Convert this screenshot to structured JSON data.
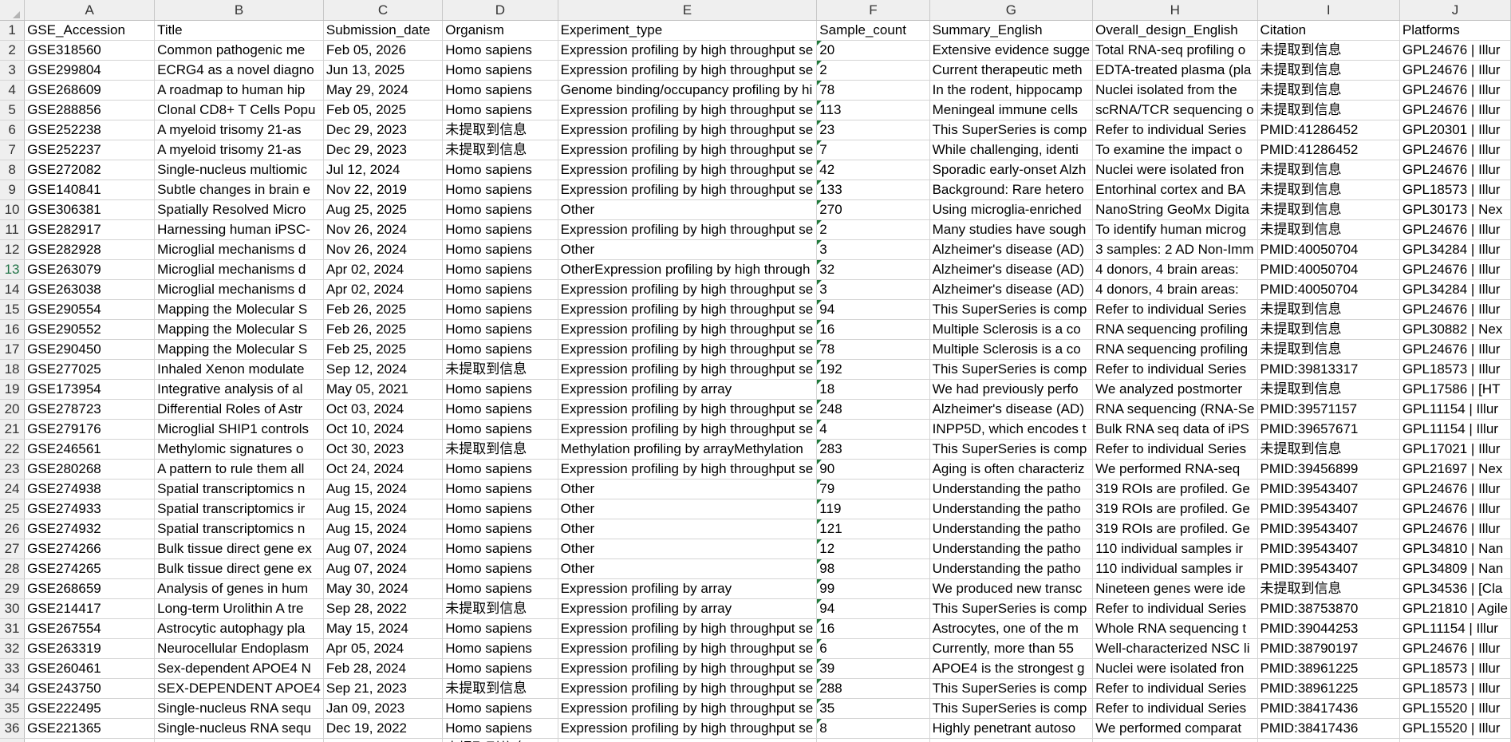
{
  "columns": [
    "A",
    "B",
    "C",
    "D",
    "E",
    "F",
    "G",
    "H",
    "I",
    "J"
  ],
  "headers": [
    "GSE_Accession",
    "Title",
    "Submission_date",
    "Organism",
    "Experiment_type",
    "Sample_count",
    "Summary_English",
    "Overall_design_English",
    "Citation",
    "Platforms"
  ],
  "rows": [
    [
      "GSE318560",
      "Common pathogenic me",
      "Feb 05, 2026",
      "Homo sapiens",
      "Expression profiling by high throughput se",
      "20",
      "Extensive evidence sugge",
      "Total RNA-seq profiling o",
      "未提取到信息",
      "GPL24676 | Illur"
    ],
    [
      "GSE299804",
      "ECRG4 as a novel diagno",
      "Jun 13, 2025",
      "Homo sapiens",
      "Expression profiling by high throughput se",
      "2",
      "Current therapeutic meth",
      "EDTA-treated plasma (pla",
      "未提取到信息",
      "GPL24676 | Illur"
    ],
    [
      "GSE268609",
      "A roadmap to human hip",
      "May 29, 2024",
      "Homo sapiens",
      "Genome binding/occupancy profiling by hi",
      "78",
      "In the rodent, hippocamp",
      "Nuclei isolated from the",
      "未提取到信息",
      "GPL24676 | Illur"
    ],
    [
      "GSE288856",
      "Clonal CD8+ T Cells Popu",
      "Feb 05, 2025",
      "Homo sapiens",
      "Expression profiling by high throughput se",
      "113",
      "Meningeal immune cells",
      "scRNA/TCR sequencing o",
      "未提取到信息",
      "GPL24676 | Illur"
    ],
    [
      "GSE252238",
      "A myeloid trisomy 21-as",
      "Dec 29, 2023",
      "未提取到信息",
      "Expression profiling by high throughput se",
      "23",
      "This SuperSeries is comp",
      "Refer to individual Series",
      "PMID:41286452",
      "GPL20301 | Illur"
    ],
    [
      "GSE252237",
      "A myeloid trisomy 21-as",
      "Dec 29, 2023",
      "未提取到信息",
      "Expression profiling by high throughput se",
      "7",
      "While challenging, identi",
      "To examine the impact o",
      "PMID:41286452",
      "GPL24676 | Illur"
    ],
    [
      "GSE272082",
      "Single-nucleus multiomic",
      "Jul 12, 2024",
      "Homo sapiens",
      "Expression profiling by high throughput se",
      "42",
      "Sporadic early-onset Alzh",
      "Nuclei were isolated fron",
      "未提取到信息",
      "GPL24676 | Illur"
    ],
    [
      "GSE140841",
      "Subtle changes in brain e",
      "Nov 22, 2019",
      "Homo sapiens",
      "Expression profiling by high throughput se",
      "133",
      "Background: Rare hetero",
      "Entorhinal cortex  and BA",
      "未提取到信息",
      "GPL18573 | Illur"
    ],
    [
      "GSE306381",
      "Spatially Resolved Micro",
      "Aug 25, 2025",
      "Homo sapiens",
      "Other",
      "270",
      "Using microglia-enriched",
      "NanoString GeoMx Digita",
      "未提取到信息",
      "GPL30173 | Nex"
    ],
    [
      "GSE282917",
      "Harnessing human iPSC-",
      "Nov 26, 2024",
      "Homo sapiens",
      "Expression profiling by high throughput se",
      "2",
      "Many studies have sough",
      "To identify human microg",
      "未提取到信息",
      "GPL24676 | Illur"
    ],
    [
      "GSE282928",
      "Microglial mechanisms d",
      "Nov 26, 2024",
      "Homo sapiens",
      "Other",
      "3",
      "Alzheimer's disease (AD)",
      "3 samples: 2 AD Non-Imm",
      "PMID:40050704",
      "GPL34284 | Illur"
    ],
    [
      "GSE263079",
      "Microglial mechanisms d",
      "Apr 02, 2024",
      "Homo sapiens",
      "OtherExpression profiling by high through",
      "32",
      "Alzheimer's disease (AD)",
      "4 donors, 4 brain areas:",
      "PMID:40050704",
      "GPL24676 | Illur"
    ],
    [
      "GSE263038",
      "Microglial mechanisms d",
      "Apr 02, 2024",
      "Homo sapiens",
      "Expression profiling by high throughput se",
      "3",
      "Alzheimer's disease (AD)",
      "4 donors, 4 brain areas:",
      "PMID:40050704",
      "GPL34284 | Illur"
    ],
    [
      "GSE290554",
      "Mapping the Molecular S",
      "Feb 26, 2025",
      "Homo sapiens",
      "Expression profiling by high throughput se",
      "94",
      "This SuperSeries is comp",
      "Refer to individual Series",
      "未提取到信息",
      "GPL24676 | Illur"
    ],
    [
      "GSE290552",
      "Mapping the Molecular S",
      "Feb 26, 2025",
      "Homo sapiens",
      "Expression profiling by high throughput se",
      "16",
      "Multiple Sclerosis is a co",
      "RNA sequencing profiling",
      "未提取到信息",
      "GPL30882 | Nex"
    ],
    [
      "GSE290450",
      "Mapping the Molecular S",
      "Feb 25, 2025",
      "Homo sapiens",
      "Expression profiling by high throughput se",
      "78",
      "Multiple Sclerosis is a co",
      "RNA sequencing profiling",
      "未提取到信息",
      "GPL24676 | Illur"
    ],
    [
      "GSE277025",
      "Inhaled Xenon modulate",
      "Sep 12, 2024",
      "未提取到信息",
      "Expression profiling by high throughput se",
      "192",
      "This SuperSeries is comp",
      "Refer to individual Series",
      "PMID:39813317",
      "GPL18573 | Illur"
    ],
    [
      "GSE173954",
      "Integrative analysis of al",
      "May 05, 2021",
      "Homo sapiens",
      "Expression profiling by array",
      "18",
      "We had previously perfo",
      "We analyzed postmorter",
      "未提取到信息",
      "GPL17586 | [HT"
    ],
    [
      "GSE278723",
      "Differential Roles of Astr",
      "Oct 03, 2024",
      "Homo sapiens",
      "Expression profiling by high throughput se",
      "248",
      "Alzheimer's disease (AD)",
      "RNA sequencing (RNA-Se",
      "PMID:39571157",
      "GPL11154 | Illur"
    ],
    [
      "GSE279176",
      "Microglial SHIP1 controls",
      "Oct 10, 2024",
      "Homo sapiens",
      "Expression profiling by high throughput se",
      "4",
      "INPP5D, which encodes t",
      "Bulk RNA seq data of iPS",
      "PMID:39657671",
      "GPL11154 | Illur"
    ],
    [
      "GSE246561",
      "Methylomic signatures o",
      "Oct 30, 2023",
      "未提取到信息",
      "Methylation profiling by arrayMethylation",
      "283",
      "This SuperSeries is comp",
      "Refer to individual Series",
      "未提取到信息",
      "GPL17021 | Illur"
    ],
    [
      "GSE280268",
      "A pattern to rule them all",
      "Oct 24, 2024",
      "Homo sapiens",
      "Expression profiling by high throughput se",
      "90",
      "Aging is often characteriz",
      "We performed RNA-seq",
      "PMID:39456899",
      "GPL21697 | Nex"
    ],
    [
      "GSE274938",
      "Spatial transcriptomics n",
      "Aug 15, 2024",
      "Homo sapiens",
      "Other",
      "79",
      "Understanding the patho",
      "319 ROIs are profiled. Ge",
      "PMID:39543407",
      "GPL24676 | Illur"
    ],
    [
      "GSE274933",
      "Spatial transcriptomics ir",
      "Aug 15, 2024",
      "Homo sapiens",
      "Other",
      "119",
      "Understanding the patho",
      "319 ROIs are profiled. Ge",
      "PMID:39543407",
      "GPL24676 | Illur"
    ],
    [
      "GSE274932",
      "Spatial transcriptomics n",
      "Aug 15, 2024",
      "Homo sapiens",
      "Other",
      "121",
      "Understanding the patho",
      "319 ROIs are profiled. Ge",
      "PMID:39543407",
      "GPL24676 | Illur"
    ],
    [
      "GSE274266",
      "Bulk tissue direct gene ex",
      "Aug 07, 2024",
      "Homo sapiens",
      "Other",
      "12",
      "Understanding the patho",
      "110 individual samples ir",
      "PMID:39543407",
      "GPL34810 | Nan"
    ],
    [
      "GSE274265",
      "Bulk tissue direct gene ex",
      "Aug 07, 2024",
      "Homo sapiens",
      "Other",
      "98",
      "Understanding the patho",
      "110 individual samples ir",
      "PMID:39543407",
      "GPL34809 | Nan"
    ],
    [
      "GSE268659",
      "Analysis of genes in hum",
      "May 30, 2024",
      "Homo sapiens",
      "Expression profiling by array",
      "99",
      "We produced new transc",
      "Nineteen genes were ide",
      "未提取到信息",
      "GPL34536 | [Cla"
    ],
    [
      "GSE214417",
      "Long-term Urolithin A tre",
      "Sep 28, 2022",
      "未提取到信息",
      "Expression profiling by array",
      "94",
      "This SuperSeries is comp",
      "Refer to individual Series",
      "PMID:38753870",
      "GPL21810 | Agile"
    ],
    [
      "GSE267554",
      "Astrocytic autophagy pla",
      "May 15, 2024",
      "Homo sapiens",
      "Expression profiling by high throughput se",
      "16",
      "Astrocytes, one of the m",
      "Whole RNA sequencing t",
      "PMID:39044253",
      "GPL11154 | Illur"
    ],
    [
      "GSE263319",
      "Neurocellular Endoplasm",
      "Apr 05, 2024",
      "Homo sapiens",
      "Expression profiling by high throughput se",
      "6",
      "Currently, more than 55",
      "Well-characterized NSC li",
      "PMID:38790197",
      "GPL24676 | Illur"
    ],
    [
      "GSE260461",
      "Sex-dependent APOE4 N",
      "Feb 28, 2024",
      "Homo sapiens",
      "Expression profiling by high throughput se",
      "39",
      "APOE4 is the strongest g",
      "Nuclei were isolated fron",
      "PMID:38961225",
      "GPL18573 | Illur"
    ],
    [
      "GSE243750",
      "SEX-DEPENDENT APOE4",
      "Sep 21, 2023",
      "未提取到信息",
      "Expression profiling by high throughput se",
      "288",
      "This SuperSeries is comp",
      "Refer to individual Series",
      "PMID:38961225",
      "GPL18573 | Illur"
    ],
    [
      "GSE222495",
      "Single-nucleus RNA sequ",
      "Jan 09, 2023",
      "Homo sapiens",
      "Expression profiling by high throughput se",
      "35",
      "This SuperSeries is comp",
      "Refer to individual Series",
      "PMID:38417436",
      "GPL15520 | Illur"
    ],
    [
      "GSE221365",
      "Single-nucleus RNA sequ",
      "Dec 19, 2022",
      "Homo sapiens",
      "Expression profiling by high throughput se",
      "8",
      "Highly penetrant autoso",
      "We performed comparat",
      "PMID:38417436",
      "GPL15520 | Illur"
    ],
    [
      "",
      "",
      "",
      "未提取到信息",
      "",
      "",
      "",
      "",
      "",
      ""
    ]
  ]
}
